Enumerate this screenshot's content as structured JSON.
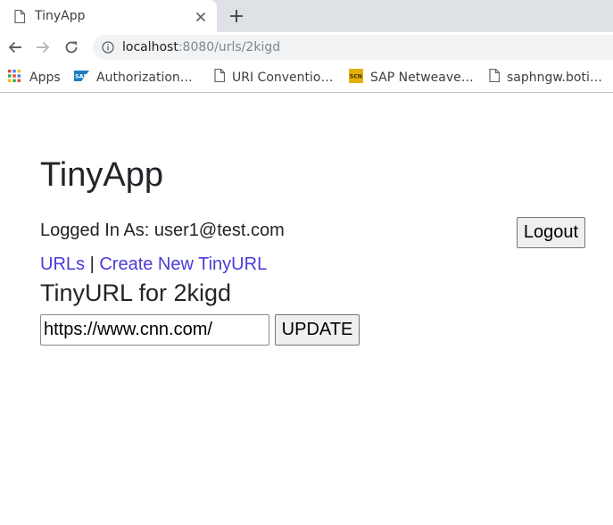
{
  "browser": {
    "tab_title": "TinyApp",
    "url_host": "localhost",
    "url_rest": ":8080/urls/2kigd",
    "bookmarks": [
      {
        "label": "Apps",
        "icon": "apps-grid-icon"
      },
      {
        "label": "Authorization…",
        "icon": "sap-logo-icon"
      },
      {
        "label": "URI Conventio…",
        "icon": "document-icon"
      },
      {
        "label": "SAP Netweave…",
        "icon": "scn-logo-icon"
      },
      {
        "label": "saphngw.boti…",
        "icon": "document-icon"
      }
    ]
  },
  "page": {
    "title": "TinyApp",
    "logged_in_prefix": "Logged In As: ",
    "user_email": "user1@test.com",
    "logout_label": "Logout",
    "nav_urls": "URLs",
    "nav_separator": "|",
    "nav_create": "Create New TinyURL",
    "subtitle": "TinyURL for 2kigd",
    "long_url_value": "https://www.cnn.com/",
    "update_label": "UPDATE"
  },
  "colors": {
    "link": "#4a3bd8",
    "text": "#212529",
    "tabbar": "#dee1e6"
  }
}
